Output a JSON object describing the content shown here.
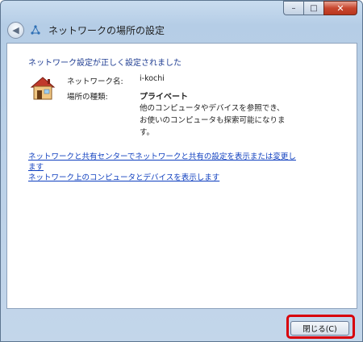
{
  "window": {
    "caption_buttons": {
      "minimize": "–",
      "maximize": "□",
      "close": "✕"
    }
  },
  "nav": {
    "title": "ネットワークの場所の設定",
    "back_glyph": "◀"
  },
  "content": {
    "success_message": "ネットワーク設定が正しく設定されました",
    "network_name_label": "ネットワーク名:",
    "network_name_value": "i-kochi",
    "location_type_label": "場所の種類:",
    "location_type_value": "プライベート",
    "location_description_line1": "他のコンピュータやデバイスを参照でき、",
    "location_description_line2": "お使いのコンピュータも探索可能になりま",
    "location_description_line3": "す。",
    "link_network_center_line1": "ネットワークと共有センターでネットワークと共有の設定を表示または変更し",
    "link_network_center_line2": "ます",
    "link_view_computers": "ネットワーク上のコンピュータとデバイスを表示します"
  },
  "footer": {
    "close_button": "閉じる(C)"
  },
  "colors": {
    "success_text": "#1e3c92",
    "link": "#0f3fbf",
    "highlight": "#d8000a"
  },
  "icons": {
    "back": "back-arrow-icon",
    "network": "network-icon",
    "house": "house-icon"
  }
}
